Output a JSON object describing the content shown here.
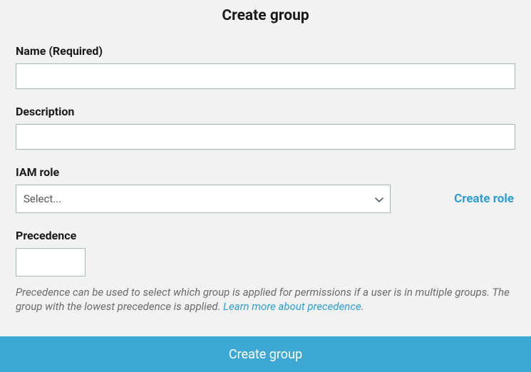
{
  "page": {
    "title": "Create group"
  },
  "fields": {
    "name": {
      "label": "Name (Required)",
      "value": ""
    },
    "description": {
      "label": "Description",
      "value": ""
    },
    "iam_role": {
      "label": "IAM role",
      "placeholder": "Select...",
      "create_role_link": "Create role"
    },
    "precedence": {
      "label": "Precedence",
      "value": "",
      "help_text_1": "Precedence can be used to select which group is applied for permissions if a user is in multiple groups. The group with the lowest precedence is applied. ",
      "help_link": "Learn more about precedence",
      "help_text_2": "."
    }
  },
  "footer": {
    "submit_label": "Create group"
  }
}
